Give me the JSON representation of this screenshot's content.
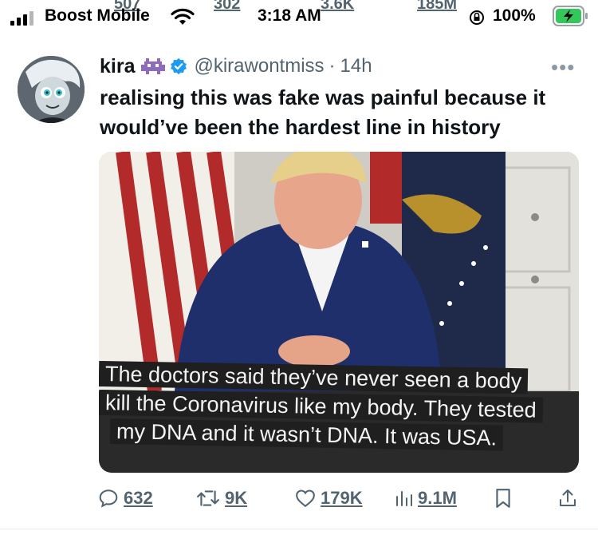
{
  "status_bar": {
    "carrier": "Boost Mobile",
    "time": "3:18 AM",
    "battery": "100%",
    "ghost_counts": [
      "507",
      "302",
      "3.6K",
      "185M"
    ]
  },
  "tweet": {
    "display_name": "kira",
    "handle": "@kirawontmiss",
    "separator": "·",
    "time": "14h",
    "more": "•••",
    "text": "realising this was fake was painful because it would’ve been the hardest line in history",
    "media": {
      "caption_lines": [
        "The doctors said they’ve never seen a body",
        "kill the Coronavirus like my body. They tested",
        "my DNA and it wasn’t DNA. It was USA."
      ]
    },
    "actions": {
      "replies": "632",
      "retweets": "9K",
      "likes": "179K",
      "views": "9.1M"
    }
  },
  "colors": {
    "accent": "#1d9bf0",
    "muted": "#536471",
    "text": "#0f1419",
    "battery_green": "#34c759"
  },
  "icons": [
    "signal-icon",
    "wifi-icon",
    "alarm-lock-icon",
    "battery-icon",
    "verified-icon",
    "alien-emoji-icon",
    "reply-icon",
    "retweet-icon",
    "like-icon",
    "views-icon",
    "bookmark-icon",
    "share-icon"
  ]
}
